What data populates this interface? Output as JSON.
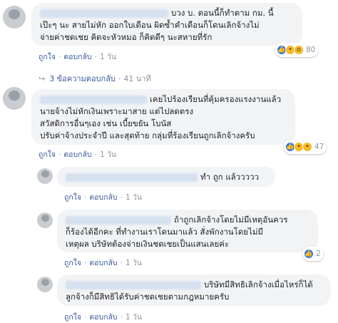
{
  "comments": [
    {
      "text_lines": [
        "บวง บ. ตอนนี้ก็ทำตาม กม. นี้",
        "เป๊ะๆ นะ สายไม่หัก ออกใบเตือน ผิดซ้ำคำเตือนก็โดนเลิกจ้างไม่",
        "จ่ายค่าชดเชย คิดจะหัวหมอ ก็คิดดีๆ นะสหายที่รัก"
      ],
      "actions": {
        "like": "ถูกใจ",
        "reply": "ตอบกลับ",
        "time": "1 วัน"
      },
      "reactions": {
        "icons": [
          "like-icon",
          "haha-icon",
          "wow-icon"
        ],
        "count": "80"
      }
    },
    {
      "text_lines": [
        "เคยไปร้องเรียนที่คุ้มครองแรงงานแล้ว",
        "นายจ้างไม่หักเงินเพราะมาสาย แต่ไปลดตรง",
        "สวัสดิการอื่นๆเอง เช่น เบี้ยขยัน โบนัส",
        "ปรับค่าจ้างประจำปี และสุดท้าย กลุ่มที่ร้องเรียนถูกเลิกจ้างครับ"
      ],
      "actions": {
        "like": "ถูกใจ",
        "reply": "ตอบกลับ",
        "time": "1 วัน"
      },
      "reactions": {
        "icons": [
          "like-icon",
          "sad-icon",
          "haha-icon"
        ],
        "count": "47"
      }
    }
  ],
  "replies_link": {
    "label": "3 ข้อความตอบกลับ",
    "time": "41 นาที"
  },
  "replies": [
    {
      "text_lines": [
        "ทำ ถูก แล้ววววว"
      ],
      "actions": {
        "like": "ถูกใจ",
        "reply": "ตอบกลับ",
        "time": "1 วัน"
      }
    },
    {
      "text_lines": [
        "ถ้าถูกเลิกจ้างโดยไม่มีเหตุอันควร",
        "ก็ร้องได้อีกคะ ที่ทำงานเราโดนมาแล้ว สั่งพักงานโดยไม่มี",
        "เหตุผล บริษัทต้องจ่ายเงินชดเชยเป็นแสนเลยค่ะ"
      ],
      "actions": {
        "like": "ถูกใจ",
        "reply": "ตอบกลับ",
        "time": "1 วัน"
      },
      "reactions": {
        "icons": [
          "like-icon"
        ],
        "count": "2"
      }
    },
    {
      "text_lines": [
        "บริษัทมีสิทธิเลิกจ้างเมื่อไหร่ก็ได้",
        "ลูกจ้างก็มีสิทธิได้รับค่าชดเชยตามกฎหมายครับ"
      ],
      "actions": {
        "like": "ถูกใจ",
        "reply": "ตอบกลับ",
        "time": "1 วัน"
      }
    }
  ],
  "colors": {
    "link": "#385898",
    "bubble": "#f2f3f5",
    "muted": "#90949c",
    "like_blue": "#3578e5"
  }
}
